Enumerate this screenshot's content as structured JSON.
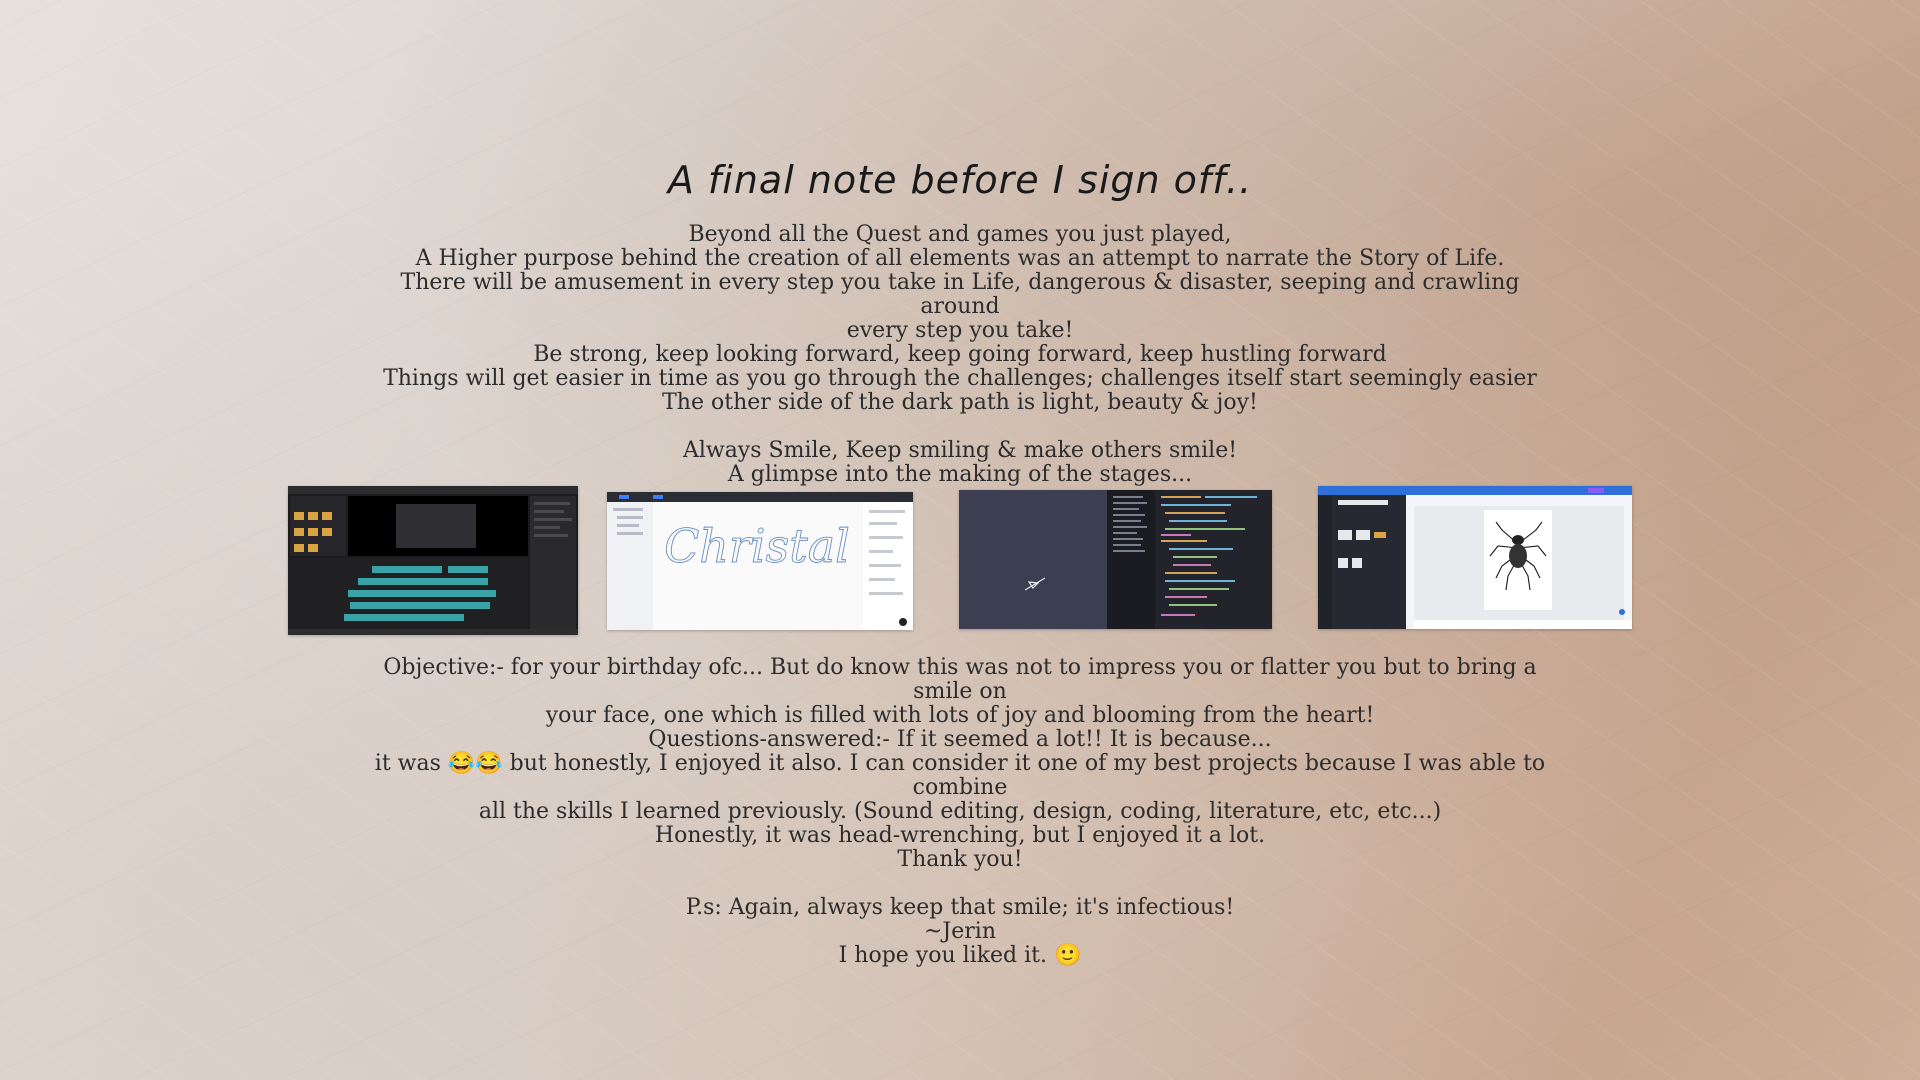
{
  "title": "A final note before I sign off..",
  "intro_lines": [
    "Beyond all the Quest and games you just played,",
    "A Higher purpose behind the creation of all elements was an attempt to narrate the Story of Life.",
    "There will be amusement in every step you take in Life, dangerous & disaster, seeping and crawling around",
    "every step you take!",
    "Be strong, keep looking forward, keep going forward, keep hustling forward",
    "Things will get easier in time as you go through the challenges; challenges itself start seemingly easier",
    "The other side of the dark path is light, beauty & joy!",
    "",
    "Always Smile, Keep smiling & make others smile!",
    "A glimpse into the making of the stages..."
  ],
  "screenshots": {
    "video_editor": "video-editor-screenshot",
    "font_design": "Christal",
    "code_editor": "code-editor-screenshot",
    "design_canvas": "spider-design-screenshot"
  },
  "outro_lines": [
    "Objective:- for your birthday ofc... But do know this was not to impress you or flatter you but to bring a smile on",
    "your face, one which is filled with lots of joy and blooming from the heart!",
    "Questions-answered:- If it seemed a lot!! It is because...",
    "it was 😂😂 but honestly, I enjoyed it also. I can consider it one of my best projects because I was able to combine",
    "all the skills I learned previously. (Sound editing, design, coding, literature, etc, etc...)",
    "Honestly, it was head-wrenching, but I enjoyed it a lot.",
    "Thank you!",
    "",
    "P.s: Again, always keep that smile; it's infectious!",
    "~Jerin",
    "I hope you liked it. 🙂"
  ]
}
